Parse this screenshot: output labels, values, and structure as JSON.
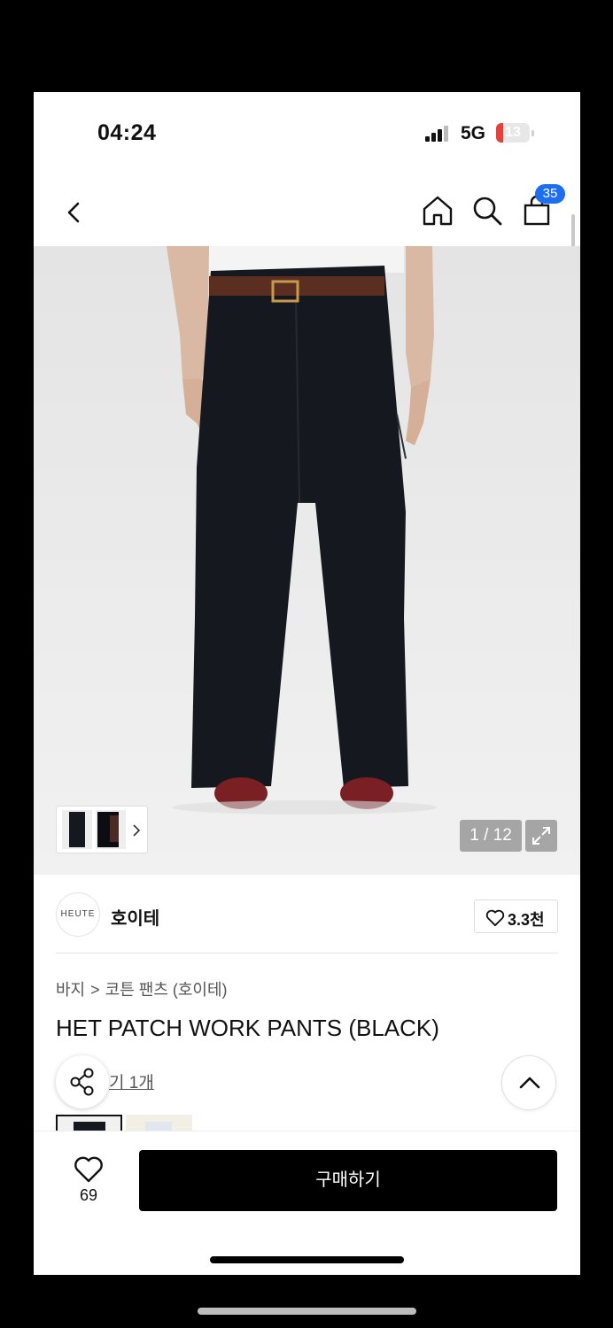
{
  "status_bar": {
    "time": "04:24",
    "network": "5G",
    "battery": "13"
  },
  "header": {
    "cart_count": "35"
  },
  "gallery": {
    "page_indicator": "1 / 12"
  },
  "brand": {
    "logo_text": "HEUTE",
    "name": "호이테",
    "likes": "3.3천"
  },
  "product": {
    "breadcrumb": {
      "category": "바지",
      "separator": ">",
      "subcategory": "코튼 팬츠 (호이테)"
    },
    "title": "HET PATCH WORK PANTS (BLACK)",
    "review_link": "기 1개"
  },
  "bottom_bar": {
    "wish_count": "69",
    "buy_label": "구매하기"
  },
  "colors": {
    "badge": "#1e6ff0",
    "buy_button": "#000000"
  }
}
